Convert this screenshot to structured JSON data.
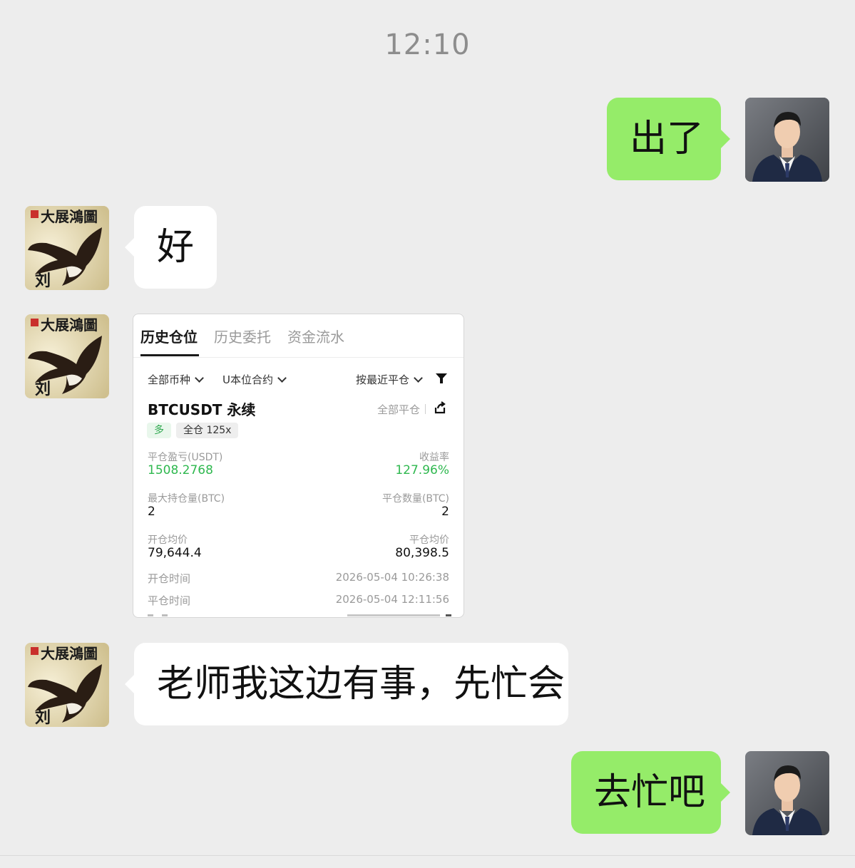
{
  "chat": {
    "time": "12:10",
    "messages": [
      {
        "sender": "me",
        "text": "出了"
      },
      {
        "sender": "other",
        "text": "好"
      },
      {
        "sender": "other",
        "type": "image"
      },
      {
        "sender": "other",
        "text": "老师我这边有事，先忙会"
      },
      {
        "sender": "me",
        "text": "去忙吧"
      }
    ]
  },
  "avatars": {
    "other_caption": "大展鴻圖",
    "other_name": "刘",
    "other_seal": "印"
  },
  "trade_card": {
    "tabs": [
      "历史仓位",
      "历史委托",
      "资金流水"
    ],
    "filters": [
      "全部币种",
      "U本位合约",
      "按最近平仓"
    ],
    "symbol": "BTCUSDT 永续",
    "close_all": "全部平仓",
    "tags": [
      "多",
      "全仓 125x"
    ],
    "pnl_label": "平仓盈亏(USDT)",
    "pnl_value": "1508.2768",
    "roi_label": "收益率",
    "roi_value": "127.96%",
    "max_pos_label": "最大持仓量(BTC)",
    "max_pos_value": "2",
    "close_qty_label": "平仓数量(BTC)",
    "close_qty_value": "2",
    "open_avg_label": "开仓均价",
    "open_avg_value": "79,644.4",
    "close_avg_label": "平仓均价",
    "close_avg_value": "80,398.5",
    "open_time_label": "开仓时间",
    "open_time_value": "2026-05-04 10:26:38",
    "close_time_label": "平仓时间",
    "close_time_value": "2026-05-04 12:11:56",
    "colors": {
      "profit": "#2fb84f",
      "accent_bubble": "#95ec69"
    }
  }
}
